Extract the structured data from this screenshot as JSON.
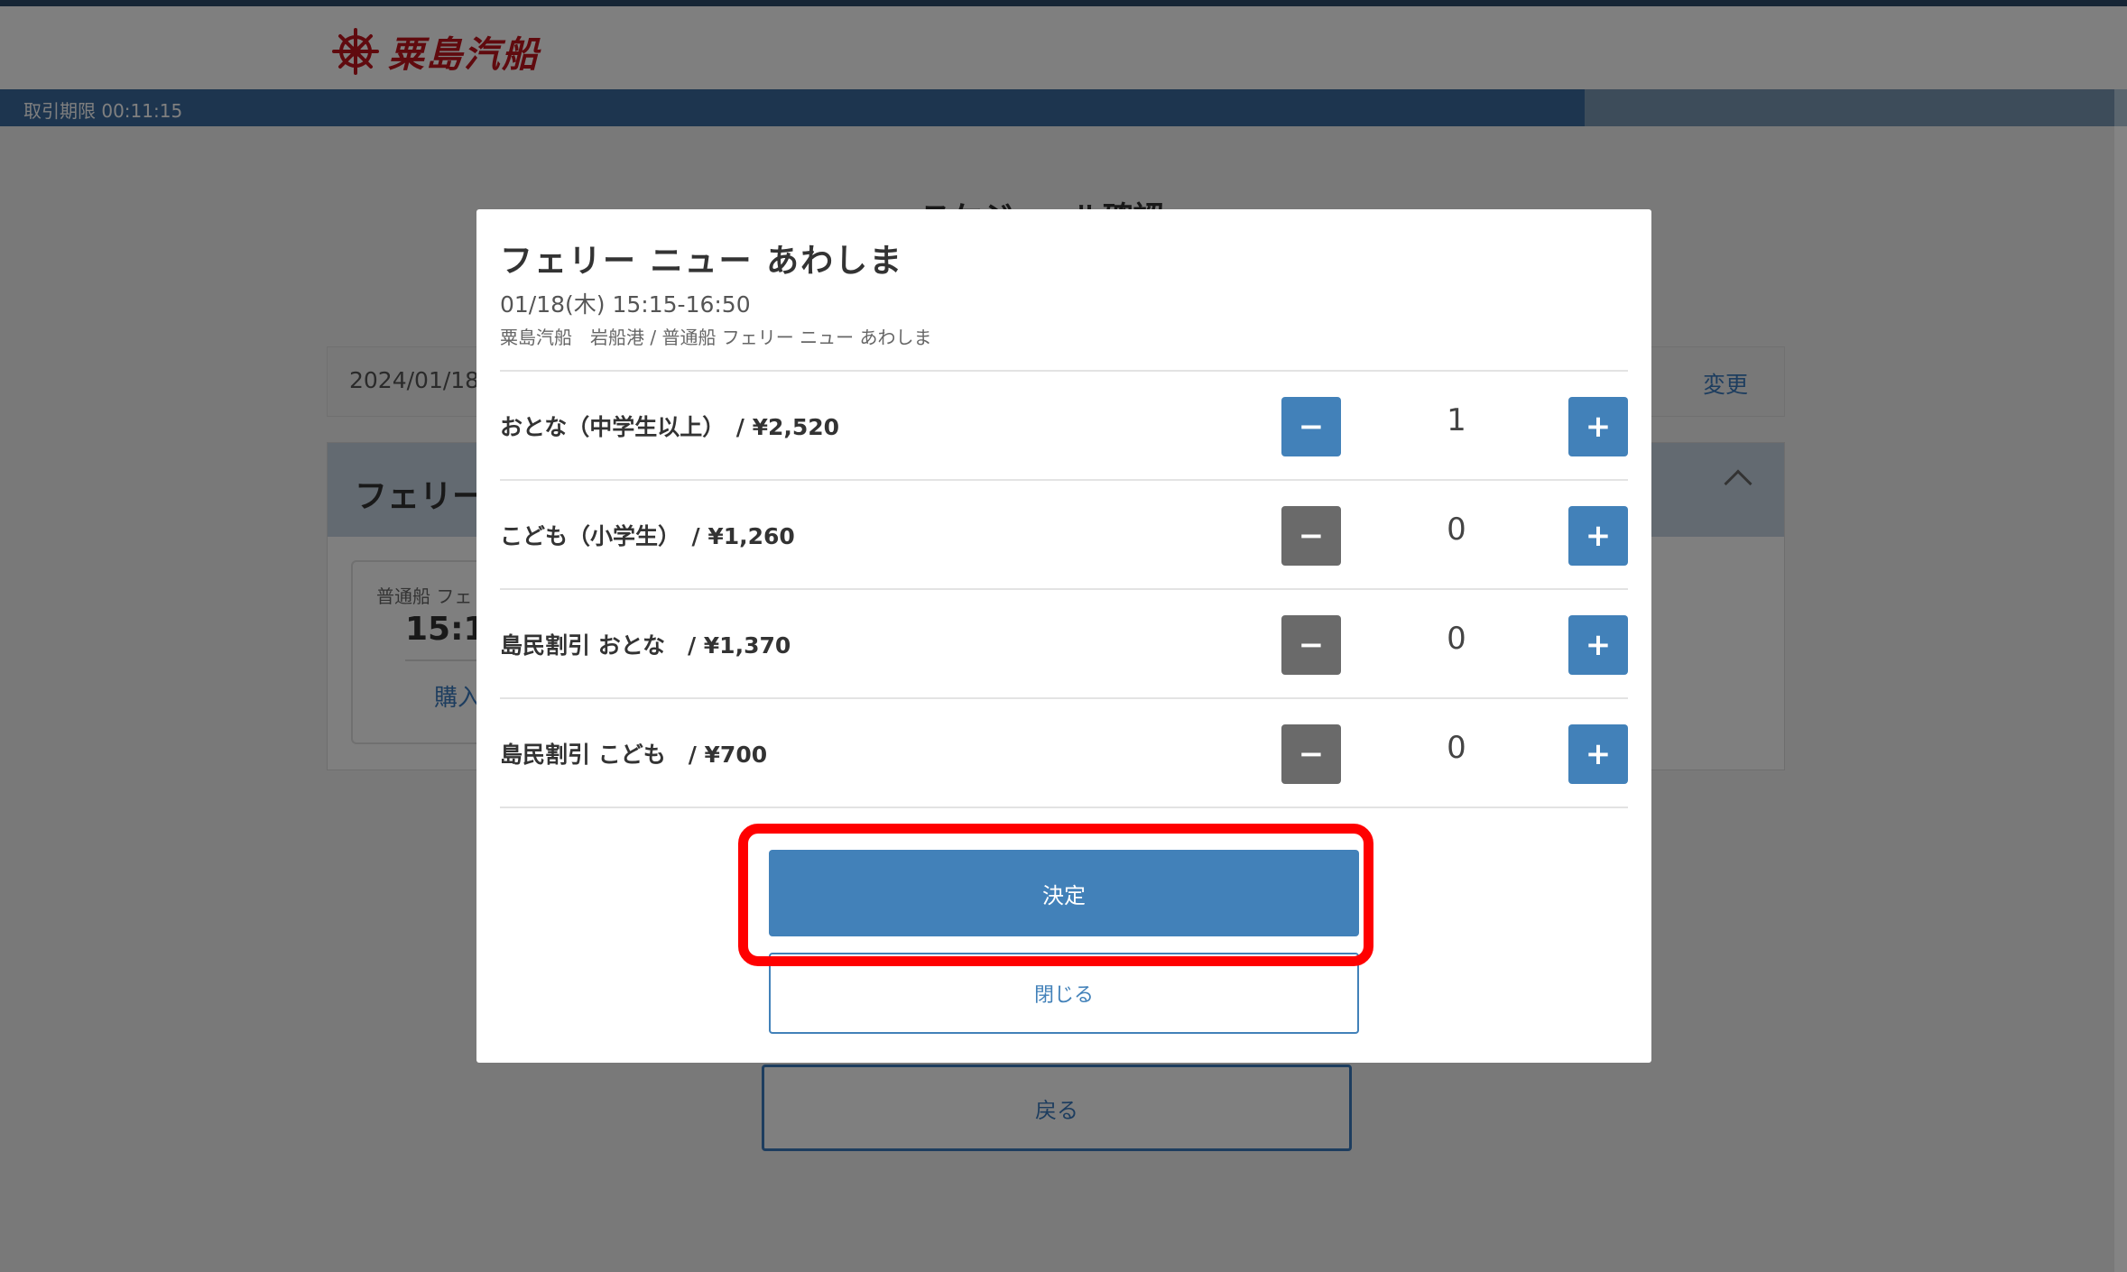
{
  "header": {
    "brand": "粟島汽船",
    "logo_icon": "ship-wheel-icon",
    "brand_color": "#c0151d"
  },
  "timer": {
    "label": "取引期限 00:11:15",
    "remaining_fraction": 0.745
  },
  "page": {
    "heading": "スケジュール確認",
    "date_value": "2024/01/18",
    "change_label": "変更",
    "ferry_section_title": "フェリー",
    "trip_ship_label": "普通船 フェ",
    "trip_time": "15:1",
    "trip_buy_label": "購入",
    "back_label": "戻る"
  },
  "modal": {
    "title": "フェリー ニュー あわしま",
    "date": "01/18(木) 15:15-16:50",
    "route": "粟島汽船　岩船港 / 普通船 フェリー ニュー あわしま",
    "fares": [
      {
        "label": "おとな（中学生以上）　/ ¥2,520",
        "qty": "1",
        "minus_enabled": true
      },
      {
        "label": "こども（小学生）　/ ¥1,260",
        "qty": "0",
        "minus_enabled": false
      },
      {
        "label": "島民割引 おとな　/ ¥1,370",
        "qty": "0",
        "minus_enabled": false
      },
      {
        "label": "島民割引 こども　/ ¥700",
        "qty": "0",
        "minus_enabled": false
      }
    ],
    "minus_symbol": "−",
    "plus_symbol": "+",
    "confirm_label": "決定",
    "close_label": "閉じる"
  },
  "colors": {
    "accent": "#4281b9",
    "disabled": "#6a6a6a",
    "highlight": "#ff0000"
  }
}
